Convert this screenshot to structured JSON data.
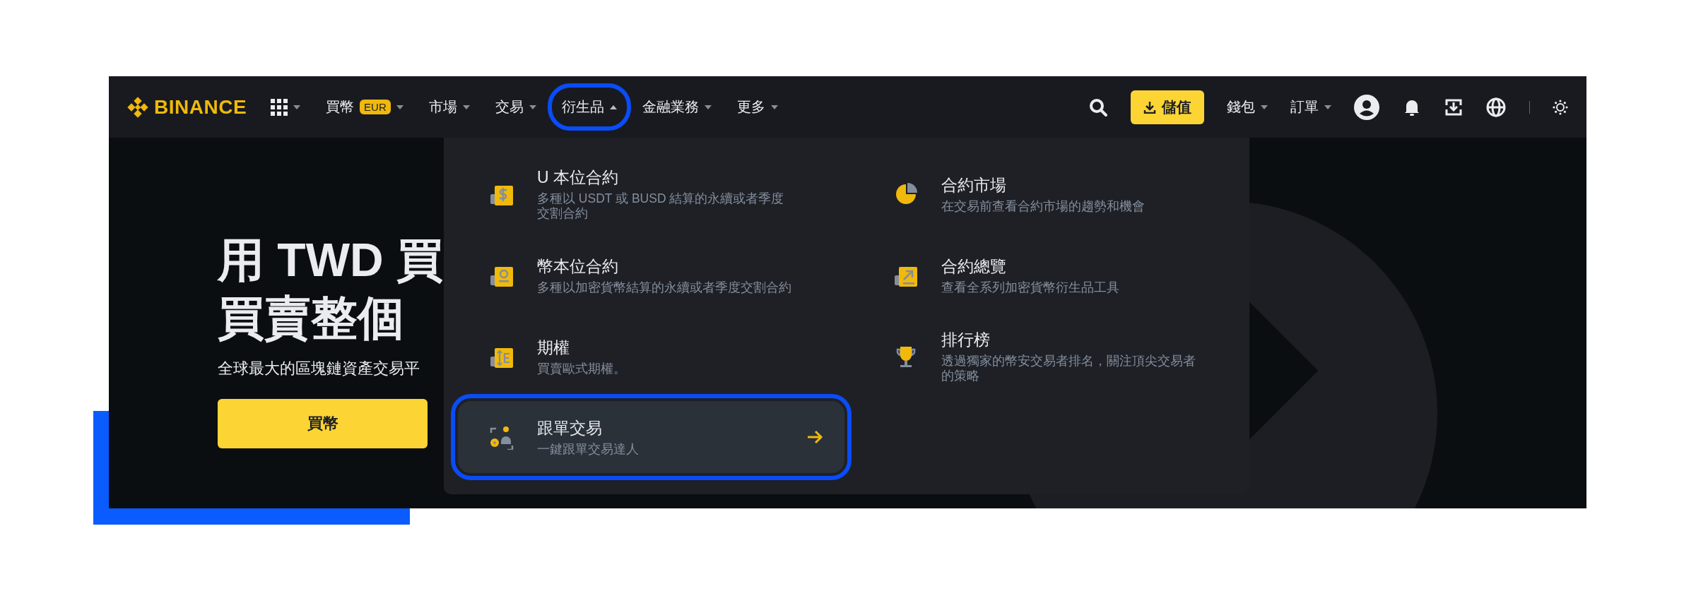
{
  "nav": {
    "logo": "BINANCE",
    "menu_items": [
      {
        "label": "買幣",
        "badge": "EUR",
        "expanded": false,
        "highlighted": false
      },
      {
        "label": "市場",
        "expanded": false,
        "highlighted": false
      },
      {
        "label": "交易",
        "expanded": false,
        "highlighted": false
      },
      {
        "label": "衍生品",
        "expanded": true,
        "highlighted": true
      },
      {
        "label": "金融業務",
        "expanded": false,
        "highlighted": false
      },
      {
        "label": "更多",
        "expanded": false,
        "highlighted": false
      }
    ],
    "deposit_button": "儲值",
    "account_items": [
      {
        "label": "錢包"
      },
      {
        "label": "訂單"
      }
    ]
  },
  "hero": {
    "headline_lines": [
      "用 TWD 買",
      "買賣整個"
    ],
    "subtitle": "全球最大的區塊鏈資產交易平",
    "button": "買幣"
  },
  "dropdown": {
    "columns": [
      [
        {
          "title": "U 本位合約",
          "description": "多種以 USDT 或 BUSD 結算的永續或者季度交割合約",
          "selected": false,
          "highlighted": false
        },
        {
          "title": "幣本位合約",
          "description": "多種以加密貨幣結算的永續或者季度交割合約",
          "selected": false,
          "highlighted": false
        },
        {
          "title": "期權",
          "description": "買賣歐式期權。",
          "selected": false,
          "highlighted": false
        },
        {
          "title": "跟單交易",
          "description": "一鍵跟單交易達人",
          "selected": true,
          "highlighted": true
        }
      ],
      [
        {
          "title": "合約市場",
          "description": "在交易前查看合約市場的趨勢和機會",
          "selected": false,
          "highlighted": false
        },
        {
          "title": "合約總覽",
          "description": "查看全系列加密貨幣衍生品工具",
          "selected": false,
          "highlighted": false
        },
        {
          "title": "排行榜",
          "description": "透過獨家的幣安交易者排名，關注頂尖交易者的策略",
          "selected": false,
          "highlighted": false
        }
      ]
    ]
  }
}
